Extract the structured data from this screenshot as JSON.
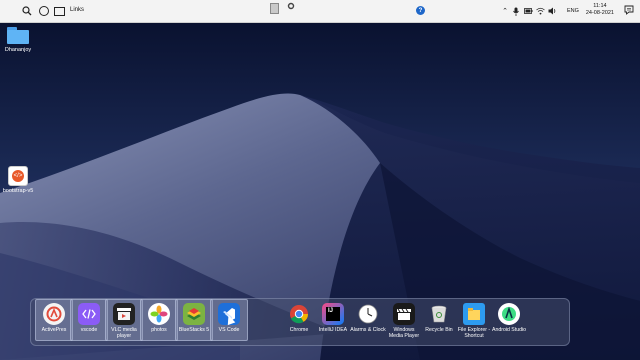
{
  "taskbar": {
    "links_label": "Links",
    "time": "11:14",
    "date": "24-08-2021",
    "language": "ENG"
  },
  "desktop": {
    "icons": [
      {
        "label": "Dhananjoy",
        "icon": "folder-icon"
      },
      {
        "label": "bootstrap-v5",
        "icon": "bootstrap-icon"
      }
    ]
  },
  "dock": {
    "left_items": [
      {
        "label": "ActivePres",
        "icon": "activepresenter-icon",
        "color": "#f4f4f4"
      },
      {
        "label": "vscode",
        "icon": "code-folder-icon",
        "color": "#8b5cf6"
      },
      {
        "label": "VLC media player",
        "icon": "video-editor-icon",
        "color": "#222222"
      },
      {
        "label": "photos",
        "icon": "photos-icon",
        "color": "#f5a623"
      },
      {
        "label": "BlueStacks 5",
        "icon": "bluestacks-icon",
        "color": "#7cb342"
      },
      {
        "label": "VS Code",
        "icon": "vscode-icon",
        "color": "#1e6fd9"
      }
    ],
    "right_items": [
      {
        "label": "Chrome",
        "icon": "chrome-icon"
      },
      {
        "label": "IntelliJ IDEA",
        "icon": "intellij-icon"
      },
      {
        "label": "Alarms & Clock",
        "icon": "clock-icon"
      },
      {
        "label": "Windows Media Player",
        "icon": "media-player-icon"
      },
      {
        "label": "Recycle Bin",
        "icon": "recycle-bin-icon"
      },
      {
        "label": "File Explorer - Shortcut",
        "icon": "file-explorer-icon"
      },
      {
        "label": "Android Studio",
        "icon": "android-studio-icon"
      }
    ]
  },
  "colors": {
    "taskbar_bg": "#f3f3f3",
    "sky_top": "#0c1530",
    "dune_highlight": "#7d86a8",
    "dock_bg": "#464e6e"
  }
}
